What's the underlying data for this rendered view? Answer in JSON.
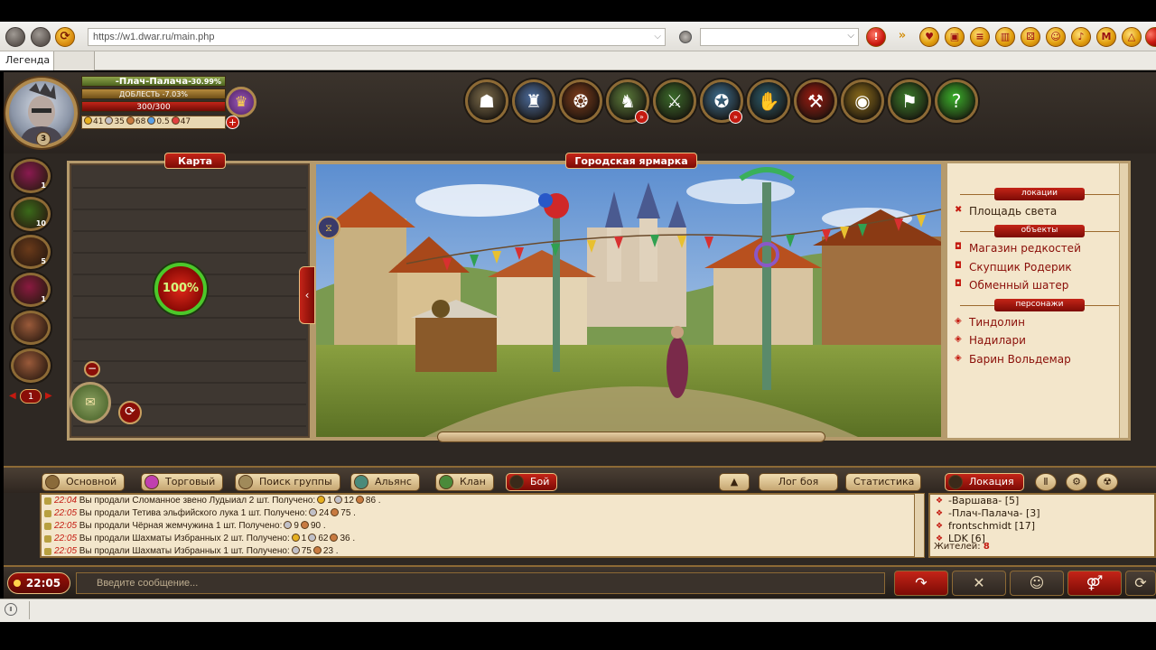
{
  "browser": {
    "url": "https://w1.dwar.ru/main.php",
    "tab_label": "Легенда"
  },
  "character": {
    "name": "-Плач-Палача-",
    "xp_percent": "30.99%",
    "valor": "ДОБЛЕСТЬ -7.03%",
    "hp": "300/300",
    "level": "3",
    "resources": [
      "41",
      "35",
      "68",
      "0.5",
      "47"
    ],
    "resource_colors": [
      "#e6b020",
      "#c0c0c8",
      "#c87a40",
      "#5aa0e6",
      "#e04040"
    ]
  },
  "top_menu": [
    {
      "name": "warrior-icon",
      "glyph": "☗",
      "bg": "#7a6a4a"
    },
    {
      "name": "castle-icon",
      "glyph": "♜",
      "bg": "#4a6a9a"
    },
    {
      "name": "bear-icon",
      "glyph": "❂",
      "bg": "#7a3a1a"
    },
    {
      "name": "knight-icon",
      "glyph": "♞",
      "bg": "#5a7a3a",
      "badge": "»"
    },
    {
      "name": "sword-icon",
      "glyph": "⚔",
      "bg": "#3a6a2a"
    },
    {
      "name": "world-map-icon",
      "glyph": "✪",
      "bg": "#3a6a8a",
      "badge": "»"
    },
    {
      "name": "cards-icon",
      "glyph": "✋",
      "bg": "#2a5a6a"
    },
    {
      "name": "axe-icon",
      "glyph": "⚒",
      "bg": "#9a1a10"
    },
    {
      "name": "gold-coins-icon",
      "glyph": "◉",
      "bg": "#8a6a1a"
    },
    {
      "name": "hammer-icon",
      "glyph": "⚑",
      "bg": "#3a7a2a"
    },
    {
      "name": "help-icon",
      "glyph": "?",
      "bg": "#3ab02a"
    }
  ],
  "side_slots": [
    {
      "count": "1",
      "bg": "#8a1a50"
    },
    {
      "count": "10",
      "bg": "#3a6a1a"
    },
    {
      "count": "5",
      "bg": "#6a3a1a"
    },
    {
      "count": "1",
      "bg": "#8a1a40"
    },
    {
      "count": "",
      "bg": "#9a5a3a"
    },
    {
      "count": "",
      "bg": "#9a5a3a"
    }
  ],
  "side_counter": "1",
  "map": {
    "label": "Карта",
    "progress": "100%"
  },
  "scene": {
    "label": "Городская ярмарка"
  },
  "location": {
    "header_locations": "локации",
    "current": "Площадь света",
    "header_objects": "объекты",
    "objects": [
      "Магазин редкостей",
      "Скупщик Родерик",
      "Обменный шатер"
    ],
    "header_characters": "персонажи",
    "characters": [
      "Тиндолин",
      "Надилари",
      "Барин Вольдемар"
    ]
  },
  "chat_tabs": {
    "main": "Основной",
    "trade": "Торговый",
    "group": "Поиск группы",
    "alliance": "Альянс",
    "clan": "Клан",
    "battle": "Бой",
    "battle_log": "Лог боя",
    "stats": "Статистика",
    "location": "Локация"
  },
  "chat_messages": [
    {
      "time": "22:04",
      "text": " Вы продали Сломанное звено Лудыиал 2 шт. Получено:",
      "coins": [
        "1",
        "12",
        "86"
      ]
    },
    {
      "time": "22:05",
      "text": " Вы продали Тетива эльфийского лука 1 шт. Получено:",
      "coins": [
        "",
        "24",
        "75"
      ]
    },
    {
      "time": "22:05",
      "text": " Вы продали Чёрная жемчужина 1 шт. Получено:",
      "coins": [
        "",
        "9",
        "90"
      ]
    },
    {
      "time": "22:05",
      "text": " Вы продали Шахматы Избранных 2 шт. Получено:",
      "coins": [
        "1",
        "62",
        "36"
      ]
    },
    {
      "time": "22:05",
      "text": " Вы продали Шахматы Избранных 1 шт. Получено:",
      "coins": [
        "",
        "75",
        "23"
      ]
    }
  ],
  "players": [
    "-Варшава- [5]",
    "-Плач-Палача- [3]",
    "frontschmidt [17]",
    "LDK [6]"
  ],
  "residents_label": "Жителей:",
  "residents_count": "8",
  "input": {
    "time": "22:05",
    "placeholder": "Введите сообщение..."
  }
}
